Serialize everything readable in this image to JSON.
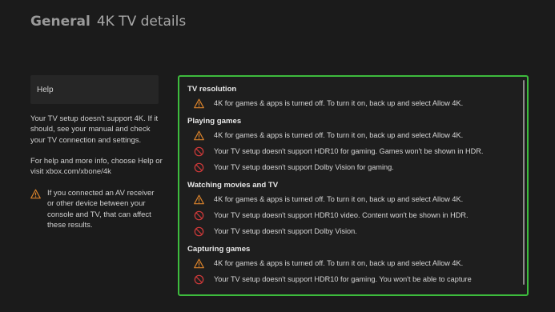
{
  "header": {
    "section": "General",
    "page": "4K TV details"
  },
  "sidebar": {
    "help_label": "Help",
    "paragraph1": "Your TV setup doesn't support 4K. If it should, see your manual and check your TV connection and settings.",
    "paragraph2": "For help and more info, choose Help or visit xbox.com/xbone/4k",
    "warning_text": "If you connected an AV receiver or other device between your console and TV, that can affect these results."
  },
  "panel": {
    "sections": [
      {
        "title": "TV resolution",
        "items": [
          {
            "icon": "warning-icon",
            "text": "4K for games & apps is turned off. To turn it on, back up and select Allow 4K."
          }
        ]
      },
      {
        "title": "Playing games",
        "items": [
          {
            "icon": "warning-icon",
            "text": "4K for games & apps is turned off. To turn it on, back up and select Allow 4K."
          },
          {
            "icon": "blocked-icon",
            "text": "Your TV setup doesn't support HDR10 for gaming. Games won't be shown in HDR."
          },
          {
            "icon": "blocked-icon",
            "text": "Your TV setup doesn't support Dolby Vision for gaming."
          }
        ]
      },
      {
        "title": "Watching movies and TV",
        "items": [
          {
            "icon": "warning-icon",
            "text": "4K for games & apps is turned off. To turn it on, back up and select Allow 4K."
          },
          {
            "icon": "blocked-icon",
            "text": "Your TV setup doesn't support HDR10 video. Content won't be shown in HDR."
          },
          {
            "icon": "blocked-icon",
            "text": "Your TV setup doesn't support Dolby Vision."
          }
        ]
      },
      {
        "title": "Capturing games",
        "items": [
          {
            "icon": "warning-icon",
            "text": "4K for games & apps is turned off. To turn it on, back up and select Allow 4K."
          },
          {
            "icon": "blocked-icon",
            "text": "Your TV setup doesn't support HDR10 for gaming. You won't be able to capture"
          }
        ]
      }
    ]
  },
  "colors": {
    "background": "#1b1b1b",
    "focus_border": "#3dbb3d",
    "warning": "#d9822b",
    "blocked": "#d43a3a"
  }
}
